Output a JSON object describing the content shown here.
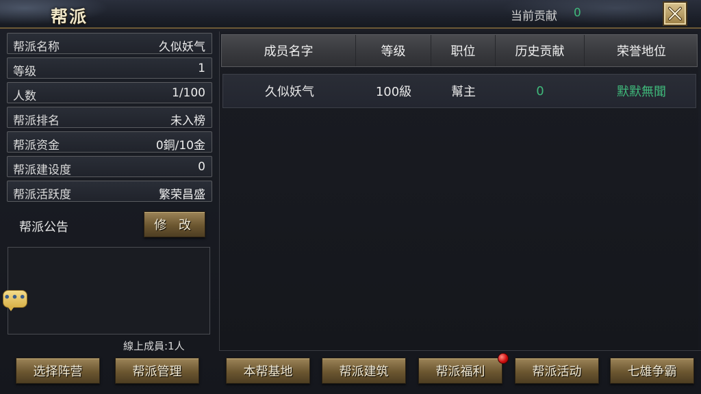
{
  "header": {
    "title": "帮派",
    "contribution_label": "当前贡献",
    "contribution_value": "0"
  },
  "info": [
    {
      "label": "帮派名称",
      "value": "久似妖气"
    },
    {
      "label": "等级",
      "value": "1"
    },
    {
      "label": "人数",
      "value": "1/100"
    },
    {
      "label": "帮派排名",
      "value": "未入榜"
    },
    {
      "label": "帮派资金",
      "value": "0銅/10金"
    },
    {
      "label": "帮派建设度",
      "value": "0"
    },
    {
      "label": "帮派活跃度",
      "value": "繁荣昌盛"
    }
  ],
  "notice": {
    "label": "帮派公告",
    "edit_button": "修 改"
  },
  "online": "線上成員:1人",
  "left_buttons": {
    "camp": "选择阵营",
    "manage": "帮派管理"
  },
  "table": {
    "headers": [
      "成员名字",
      "等级",
      "职位",
      "历史贡献",
      "荣誉地位"
    ],
    "rows": [
      [
        "久似妖气",
        "100級",
        "幫主",
        "0",
        "默默無聞"
      ]
    ]
  },
  "tabs": [
    "本帮基地",
    "帮派建筑",
    "帮派福利",
    "帮派活动",
    "七雄争霸"
  ],
  "colors": {
    "accent_green": "#3fb87a",
    "gold_button": "#6b5630",
    "notification_dot": "#d01010"
  },
  "icons": {
    "close": "close-icon",
    "chat": "chat-bubble-icon",
    "notification": "notification-dot-icon"
  }
}
